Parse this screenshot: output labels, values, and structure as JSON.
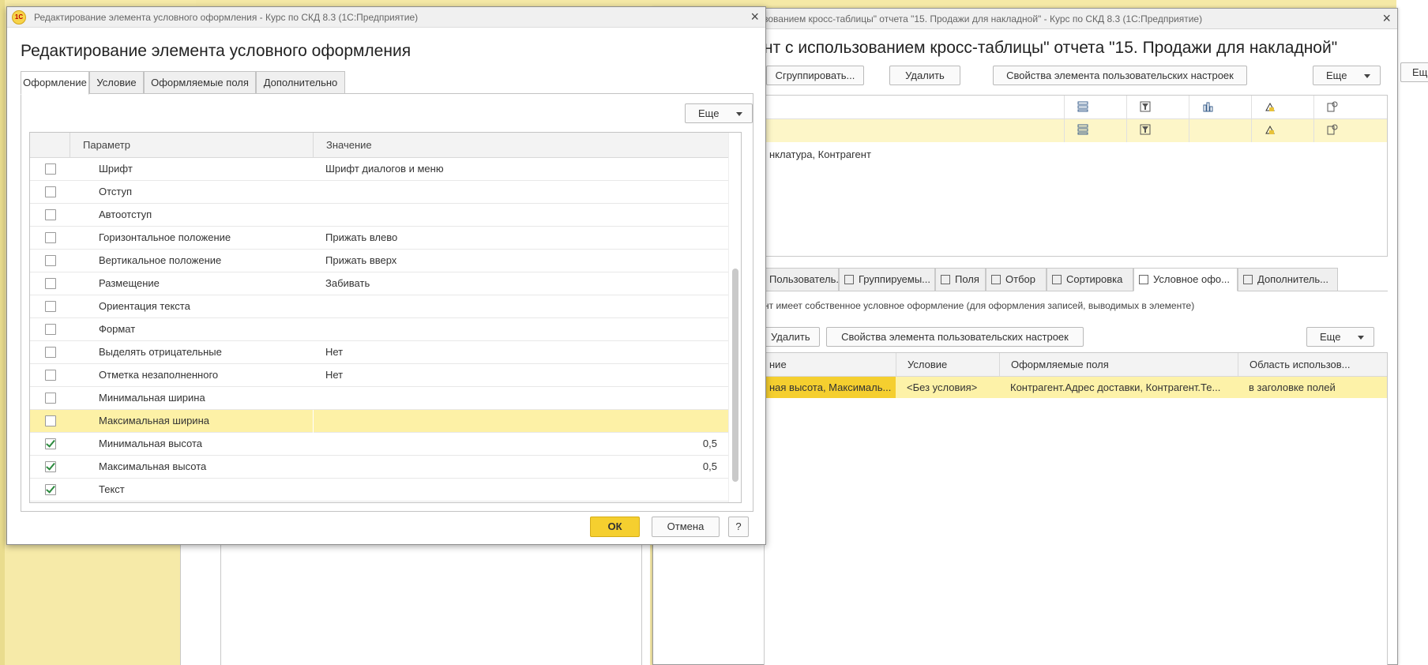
{
  "background_window": {
    "title": "...Элемент с использованием кросс-таблицы\" отчета \"15. Продажи для накладной\" - Курс по СКД 8.3 (1С:Предприятие)",
    "title_visible": "зованием кросс-таблицы\" отчета \"15. Продажи для накладной\" - Курс по СКД 8.3  (1С:Предприятие)",
    "heading": "нт с использованием кросс-таблицы\" отчета \"15. Продажи для накладной\"",
    "toolbar": {
      "group_label": "Сгруппировать...",
      "delete_label": "Удалить",
      "properties_label": "Свойства элемента пользовательских настроек",
      "more_label": "Еще"
    },
    "top_grid_text": "нклатура, Контрагент",
    "tabs": [
      {
        "label": "Пользователь..."
      },
      {
        "label": "Группируемы..."
      },
      {
        "label": "Поля"
      },
      {
        "label": "Отбор"
      },
      {
        "label": "Сортировка"
      },
      {
        "label": "Условное офо..."
      },
      {
        "label": "Дополнитель..."
      }
    ],
    "info_text": "нт имеет собственное условное оформление (для оформления записей, выводимых в элементе)",
    "toolbar2": {
      "delete_label": "Удалить",
      "properties_label": "Свойства элемента пользовательских настроек",
      "more_label": "Еще"
    },
    "grid2": {
      "columns": [
        "ние",
        "Условие",
        "Оформляемые поля",
        "Область использов..."
      ],
      "row": [
        "ная высота, Максималь...",
        "<Без условия>",
        "Контрагент.Адрес доставки, Контрагент.Те...",
        "в заголовке полей"
      ]
    },
    "right_more_label": "Ещ"
  },
  "dialog": {
    "logo_text": "1С",
    "title": "Редактирование элемента условного оформления - Курс по СКД 8.3  (1С:Предприятие)",
    "close_glyph": "×",
    "heading": "Редактирование элемента условного оформления",
    "tabs": [
      {
        "label": "Оформление",
        "active": true
      },
      {
        "label": "Условие",
        "active": false
      },
      {
        "label": "Оформляемые поля",
        "active": false
      },
      {
        "label": "Дополнительно",
        "active": false
      }
    ],
    "more_label": "Еще",
    "table": {
      "col_param": "Параметр",
      "col_value": "Значение",
      "rows": [
        {
          "checked": false,
          "name": "Шрифт",
          "value": "Шрифт диалогов и меню",
          "num": ""
        },
        {
          "checked": false,
          "name": "Отступ",
          "value": "",
          "num": ""
        },
        {
          "checked": false,
          "name": "Автоотступ",
          "value": "",
          "num": ""
        },
        {
          "checked": false,
          "name": "Горизонтальное положение",
          "value": "Прижать влево",
          "num": ""
        },
        {
          "checked": false,
          "name": "Вертикальное положение",
          "value": "Прижать вверх",
          "num": ""
        },
        {
          "checked": false,
          "name": "Размещение",
          "value": "Забивать",
          "num": ""
        },
        {
          "checked": false,
          "name": "Ориентация текста",
          "value": "",
          "num": ""
        },
        {
          "checked": false,
          "name": "Формат",
          "value": "",
          "num": ""
        },
        {
          "checked": false,
          "name": "Выделять отрицательные",
          "value": "Нет",
          "num": ""
        },
        {
          "checked": false,
          "name": "Отметка незаполненного",
          "value": "Нет",
          "num": ""
        },
        {
          "checked": false,
          "name": "Минимальная ширина",
          "value": "",
          "num": ""
        },
        {
          "checked": false,
          "name": "Максимальная ширина",
          "value": "",
          "num": "",
          "selected": true
        },
        {
          "checked": true,
          "name": "Минимальная высота",
          "value": "",
          "num": "0,5"
        },
        {
          "checked": true,
          "name": "Максимальная высота",
          "value": "",
          "num": "0,5"
        },
        {
          "checked": true,
          "name": "Текст",
          "value": "",
          "num": ""
        }
      ]
    },
    "buttons": {
      "ok": "ОК",
      "cancel": "Отмена",
      "help": "?"
    }
  },
  "colors": {
    "accent_yellow": "#f5cf2f",
    "selected_row": "#fdf1a6",
    "check_green": "#2c8a3e",
    "desktop": "#f5e9a6"
  }
}
